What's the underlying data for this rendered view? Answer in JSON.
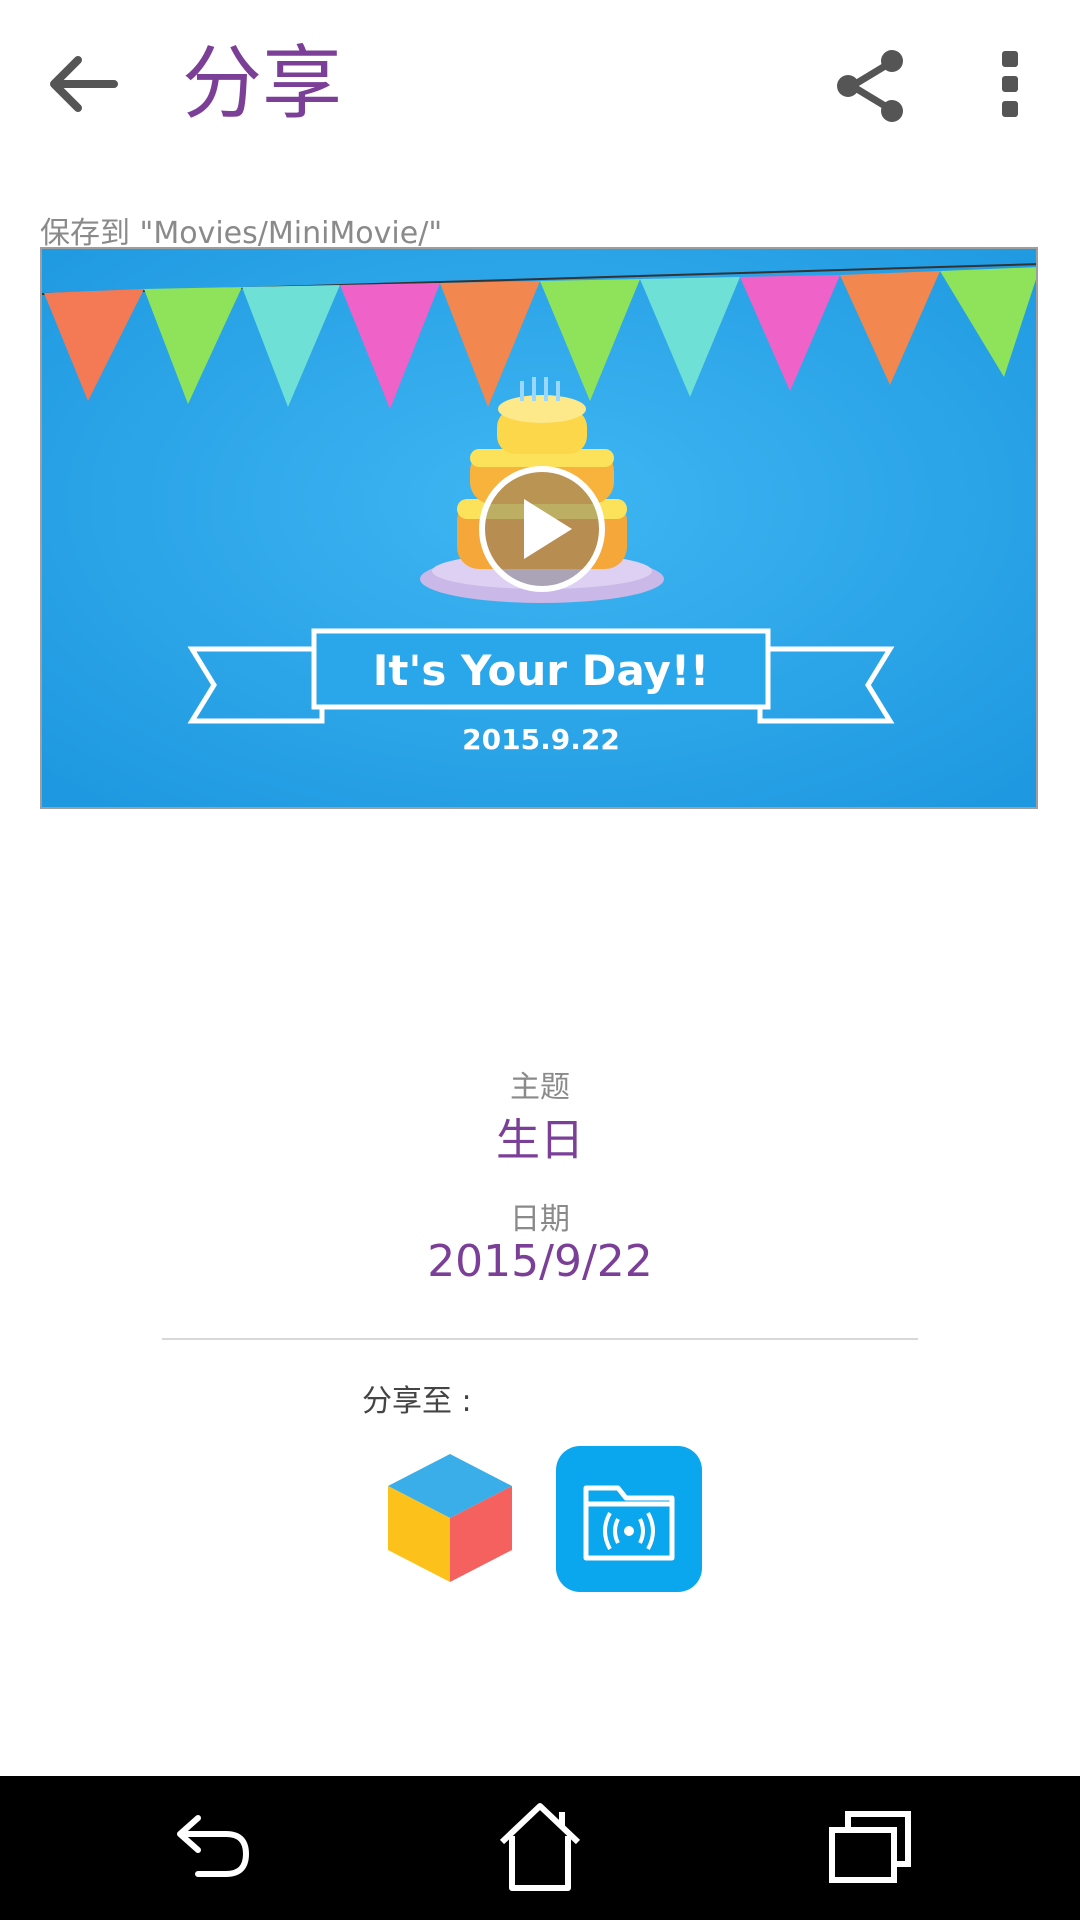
{
  "colors": {
    "accent": "#7b3f98",
    "icon": "#555555",
    "label": "#8a8a8a",
    "preview_bg": "#2aa6ea",
    "nav_bar": "#000000"
  },
  "appbar": {
    "title": "分享",
    "back_icon": "arrow-left-icon",
    "share_icon": "share-icon",
    "more_icon": "more-vertical-icon"
  },
  "save_path": "保存到 \"Movies/MiniMovie/\"",
  "preview": {
    "banner_text": "It's Your Day!!",
    "date_text": "2015.9.22",
    "play_icon": "play-icon"
  },
  "details": {
    "theme_label": "主题",
    "theme_value": "生日",
    "date_label": "日期",
    "date_value": "2015/9/22"
  },
  "share_to_label": "分享至 :",
  "share_apps": [
    {
      "icon": "cube-app-icon"
    },
    {
      "icon": "wireless-folder-app-icon"
    }
  ],
  "navbar": {
    "back_icon": "nav-back-icon",
    "home_icon": "nav-home-icon",
    "recent_icon": "nav-recent-apps-icon"
  }
}
